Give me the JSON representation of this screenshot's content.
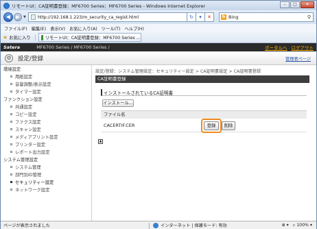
{
  "window": {
    "title": "リモートUI：CA証明書登録：MF6700 Series：MF6700 Series - Windows Internet Explorer"
  },
  "toolbar": {
    "url": "http://192.168.1.223/m_security_ca_regist.html",
    "search_engine": "Bing",
    "search_icon": "search-icon"
  },
  "menu": [
    "ファイル(F)",
    "編集(E)",
    "表示(V)",
    "お気に入り(A)",
    "ツール(T)",
    "ヘルプ(H)"
  ],
  "favorites": {
    "label": "お気に入り",
    "tab_title": "リモートUI：CA証明書登録：MF6700 Series ..."
  },
  "header": {
    "brand": "Satera",
    "model": "MF6700 Series / MF6700 Series /",
    "portal": "ポータルへ",
    "logout": "ログアウト",
    "page_title": "設定/登録",
    "manager_link": "管理者ページ"
  },
  "sidebar": [
    {
      "label": "環境設定",
      "type": "cat"
    },
    {
      "label": "用紙設定",
      "type": "sub"
    },
    {
      "label": "音量調整/表示設定",
      "type": "sub"
    },
    {
      "label": "タイマー設定",
      "type": "sub"
    },
    {
      "label": "ファンクション設定",
      "type": "cat"
    },
    {
      "label": "共通設定",
      "type": "sub"
    },
    {
      "label": "コピー設定",
      "type": "sub"
    },
    {
      "label": "ファクス設定",
      "type": "sub"
    },
    {
      "label": "スキャン設定",
      "type": "sub"
    },
    {
      "label": "メディアプリント設定",
      "type": "sub"
    },
    {
      "label": "プリンター設定",
      "type": "sub"
    },
    {
      "label": "レポート出力設定",
      "type": "sub"
    },
    {
      "label": "システム管理設定",
      "type": "cat"
    },
    {
      "label": "システム管理",
      "type": "sub"
    },
    {
      "label": "部門別ID管理",
      "type": "sub"
    },
    {
      "label": "セキュリティー設定",
      "type": "sub",
      "active": true
    },
    {
      "label": "ネットワーク設定",
      "type": "sub"
    }
  ],
  "main": {
    "breadcrumb": "設定/登録：システム管理設定：セキュリティー設定 > CA証明書設定 > CA証明書登録",
    "section_title": "CA証明書登録",
    "subheading": "インストールされているCA証明書",
    "install_button": "インストール...",
    "table_header": "ファイル名",
    "file_name": "CACERTIF.CER",
    "register_button": "登録",
    "delete_button": "削除"
  },
  "status": {
    "left": "ページが表示されました",
    "zone": "インターネット | 保護モード: 有効",
    "zoom": "100%"
  }
}
